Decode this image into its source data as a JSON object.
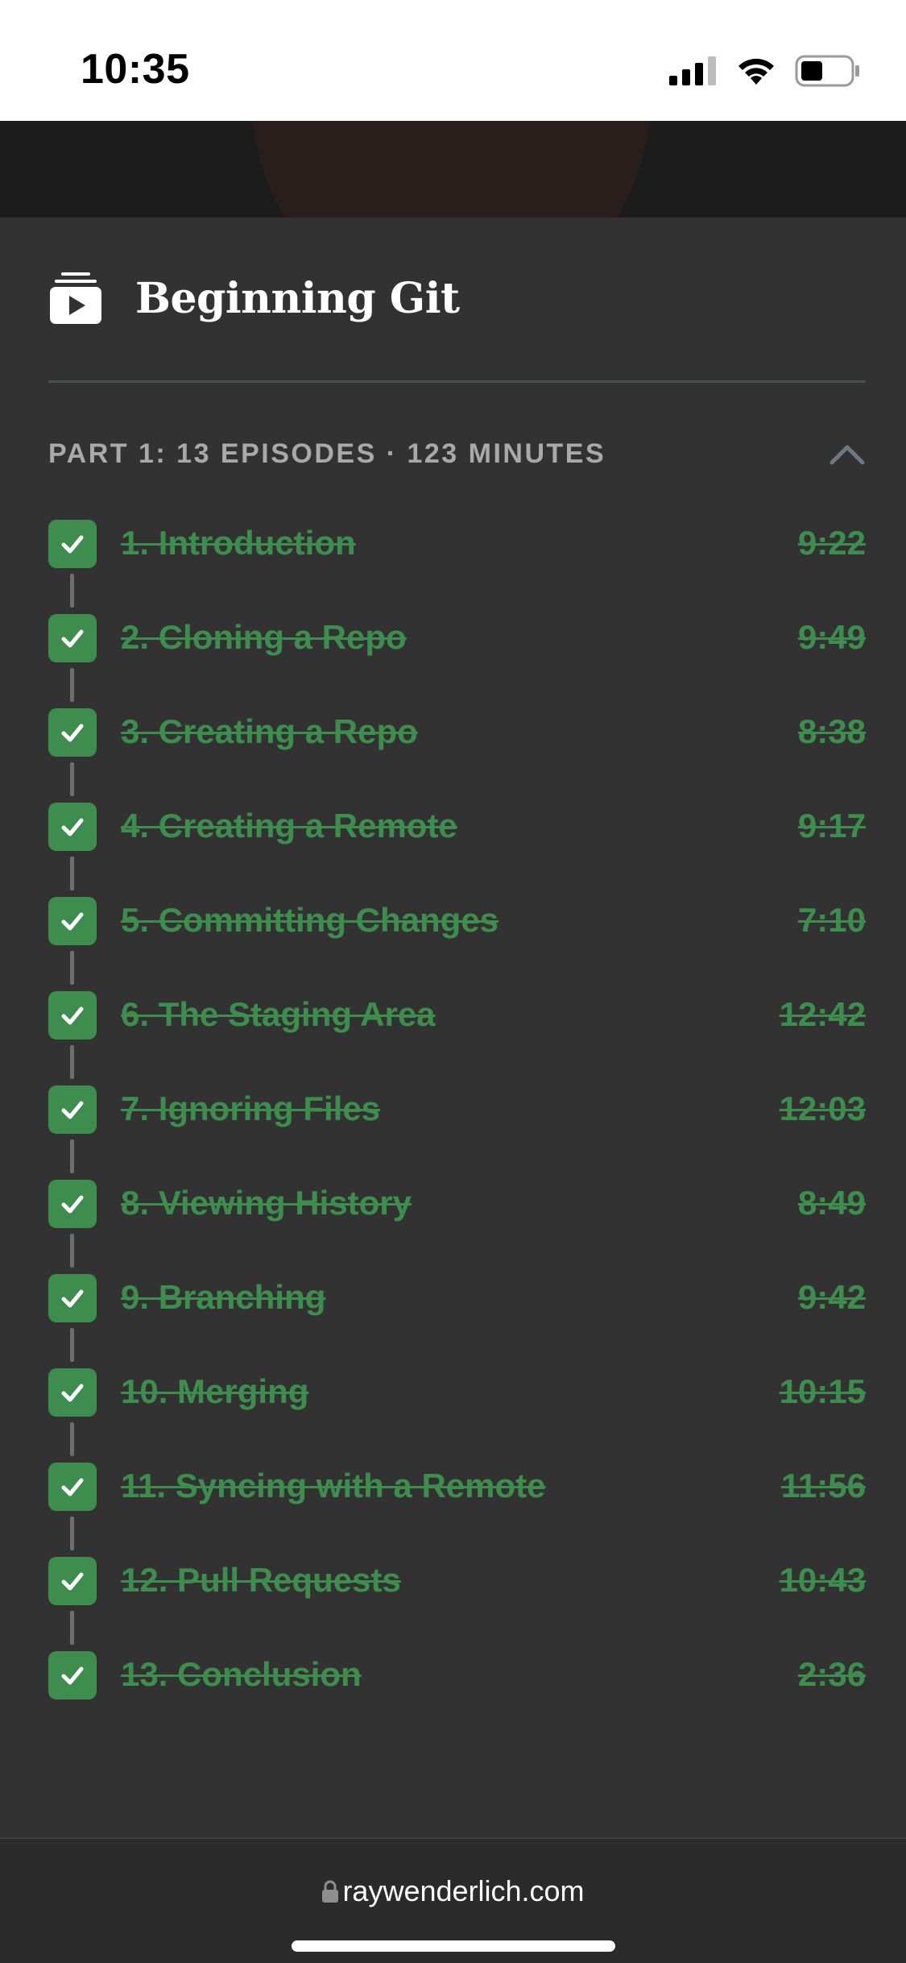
{
  "status_bar": {
    "time": "10:35",
    "icons": [
      "signal-icon",
      "wifi-icon",
      "battery-icon"
    ]
  },
  "course": {
    "title": "Beginning Git",
    "icon": "video-playlist-icon"
  },
  "part": {
    "label": "PART 1: 13 EPISODES · 123 MINUTES",
    "expanded": true
  },
  "episodes": [
    {
      "title": "1. Introduction",
      "duration": "9:22",
      "completed": true
    },
    {
      "title": "2. Cloning a Repo",
      "duration": "9:49",
      "completed": true
    },
    {
      "title": "3. Creating a Repo",
      "duration": "8:38",
      "completed": true
    },
    {
      "title": "4. Creating a Remote",
      "duration": "9:17",
      "completed": true
    },
    {
      "title": "5. Committing Changes",
      "duration": "7:10",
      "completed": true
    },
    {
      "title": "6. The Staging Area",
      "duration": "12:42",
      "completed": true
    },
    {
      "title": "7. Ignoring Files",
      "duration": "12:03",
      "completed": true
    },
    {
      "title": "8. Viewing History",
      "duration": "8:49",
      "completed": true
    },
    {
      "title": "9. Branching",
      "duration": "9:42",
      "completed": true
    },
    {
      "title": "10. Merging",
      "duration": "10:15",
      "completed": true
    },
    {
      "title": "11. Syncing with a Remote",
      "duration": "11:56",
      "completed": true
    },
    {
      "title": "12. Pull Requests",
      "duration": "10:43",
      "completed": true
    },
    {
      "title": "13. Conclusion",
      "duration": "2:36",
      "completed": true
    }
  ],
  "browser": {
    "url": "raywenderlich.com"
  },
  "colors": {
    "completed_green": "#3e8c4e",
    "background": "#323232"
  }
}
